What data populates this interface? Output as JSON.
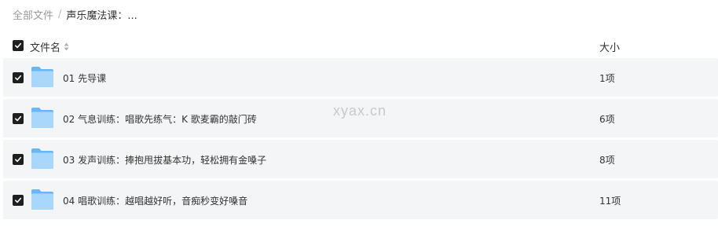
{
  "breadcrumb": {
    "root": "全部文件",
    "separator": "/",
    "current": "声乐魔法课：..."
  },
  "header": {
    "name_label": "文件名",
    "size_label": "大小"
  },
  "rows": [
    {
      "name": "01 先导课",
      "size": "1项",
      "checked": true,
      "icon": "folder-icon"
    },
    {
      "name": "02 气息训练：唱歌先练气：K 歌麦霸的敲门砖",
      "size": "6项",
      "checked": true,
      "icon": "folder-icon"
    },
    {
      "name": "03 发声训练：捧抱甩拔基本功，轻松拥有金嗓子",
      "size": "8项",
      "checked": true,
      "icon": "folder-icon"
    },
    {
      "name": "04 唱歌训练：越唱越好听，音痴秒变好嗓音",
      "size": "11项",
      "checked": true,
      "icon": "folder-icon"
    }
  ],
  "watermark": "xyax.cn",
  "colors": {
    "row_bg": "#f4f5f7",
    "checkbox": "#1f1f1f",
    "folder_light": "#a9d6fb",
    "folder_dark": "#6ab7f6",
    "muted_text": "#999999"
  }
}
